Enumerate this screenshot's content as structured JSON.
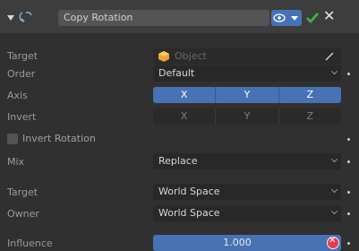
{
  "header": {
    "name": "Copy Rotation"
  },
  "rows": {
    "target": {
      "label": "Target",
      "placeholder": "Object"
    },
    "order": {
      "label": "Order",
      "value": "Default"
    },
    "axis": {
      "label": "Axis",
      "x": "X",
      "y": "Y",
      "z": "Z"
    },
    "invert": {
      "label": "Invert",
      "x": "X",
      "y": "Y",
      "z": "Z"
    },
    "invert_rotation": {
      "label": "Invert Rotation",
      "checked": false
    },
    "mix": {
      "label": "Mix",
      "value": "Replace"
    },
    "target_space": {
      "label": "Target",
      "value": "World Space"
    },
    "owner_space": {
      "label": "Owner",
      "value": "World Space"
    },
    "influence": {
      "label": "Influence",
      "value": "1.000"
    }
  },
  "colors": {
    "accent": "#4772b3",
    "panel": "#303030",
    "header": "#3d3d3d",
    "field": "#282828",
    "check_green": "#3fa33f",
    "remove_red": "#e33b4e"
  }
}
